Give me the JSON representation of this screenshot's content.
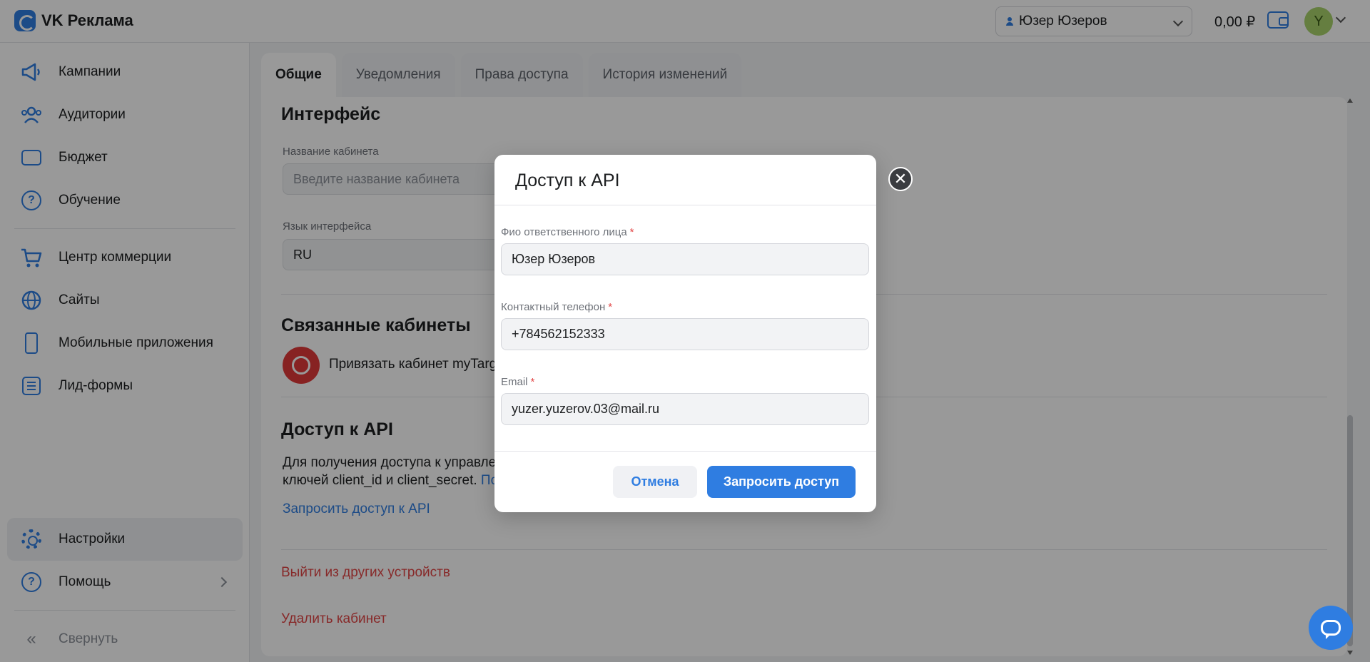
{
  "topbar": {
    "logo_text": "VK Реклама",
    "account_name": "Юзер Юзеров",
    "balance": "0,00 ₽",
    "avatar_letter": "Y"
  },
  "sidebar": {
    "items": [
      {
        "label": "Кампании",
        "icon": "megaphone-icon"
      },
      {
        "label": "Аудитории",
        "icon": "users-icon"
      },
      {
        "label": "Бюджет",
        "icon": "wallet-icon"
      },
      {
        "label": "Обучение",
        "icon": "question-icon"
      },
      {
        "label": "Центр коммерции",
        "icon": "cart-icon"
      },
      {
        "label": "Сайты",
        "icon": "globe-icon"
      },
      {
        "label": "Мобильные приложения",
        "icon": "phone-icon"
      },
      {
        "label": "Лид-формы",
        "icon": "list-icon"
      },
      {
        "label": "Настройки",
        "icon": "gear-icon"
      },
      {
        "label": "Помощь",
        "icon": "help-icon"
      },
      {
        "label": "Свернуть",
        "icon": "collapse-icon"
      }
    ]
  },
  "tabs": [
    "Общие",
    "Уведомления",
    "Права доступа",
    "История изменений"
  ],
  "content": {
    "interface_title": "Интерфейс",
    "cabinet_name_label": "Название кабинета",
    "cabinet_name_placeholder": "Введите название кабинета",
    "language_label": "Язык интерфейса",
    "language_value": "RU",
    "linked_title": "Связанные кабинеты",
    "mytarget_text": "Привязать кабинет myTarge",
    "api_title": "Доступ к API",
    "api_text_1": "Для получения доступа к управлен",
    "api_text_2": "ключей client_id и client_secret.",
    "api_text_link": "По",
    "api_request_link": "Запросить доступ к API",
    "logout_others": "Выйти из других устройств",
    "delete_cabinet": "Удалить кабинет"
  },
  "modal": {
    "title": "Доступ к API",
    "fio_label": "Фио ответственного лица",
    "fio_value": "Юзер Юзеров",
    "phone_label": "Контактный телефон",
    "phone_value": "+784562152333",
    "email_label": "Email",
    "email_value": "yuzer.yuzerov.03@mail.ru",
    "required_mark": "*",
    "cancel_label": "Отмена",
    "submit_label": "Запросить доступ",
    "close_glyph": "✕"
  },
  "colors": {
    "accent": "#2f7de1",
    "danger": "#e24545",
    "avatar": "#a8d36b"
  }
}
